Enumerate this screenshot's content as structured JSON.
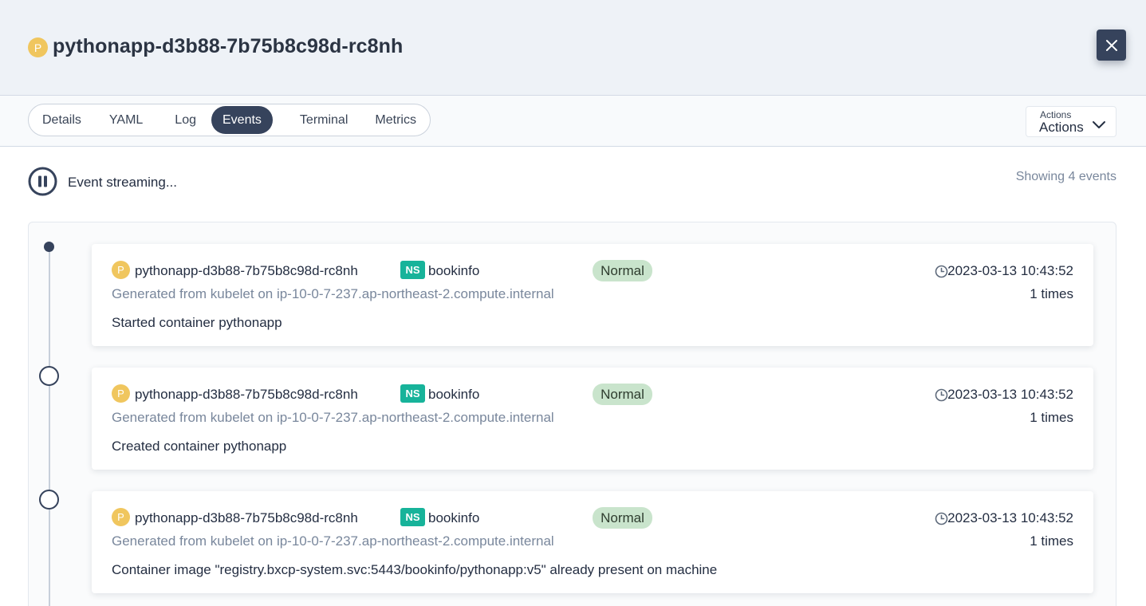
{
  "header": {
    "pod_badge": "P",
    "title": "pythonapp-d3b88-7b75b8c98d-rc8nh",
    "close_icon": "close-icon"
  },
  "tabs": [
    {
      "label": "Details",
      "active": false
    },
    {
      "label": "YAML",
      "active": false
    },
    {
      "label": "Log",
      "active": false
    },
    {
      "label": "Events",
      "active": true
    },
    {
      "label": "Terminal",
      "active": false
    },
    {
      "label": "Metrics",
      "active": false
    }
  ],
  "actions": {
    "small_label": "Actions",
    "label": "Actions"
  },
  "stream": {
    "label": "Event streaming...",
    "showing": "Showing 4 events"
  },
  "events": [
    {
      "pod_badge": "P",
      "pod": "pythonapp-d3b88-7b75b8c98d-rc8nh",
      "ns_badge": "NS",
      "namespace": "bookinfo",
      "type": "Normal",
      "time": "2023-03-13 10:43:52",
      "source": "Generated from kubelet on ip-10-0-7-237.ap-northeast-2.compute.internal",
      "count": "1 times",
      "message": "Started container pythonapp"
    },
    {
      "pod_badge": "P",
      "pod": "pythonapp-d3b88-7b75b8c98d-rc8nh",
      "ns_badge": "NS",
      "namespace": "bookinfo",
      "type": "Normal",
      "time": "2023-03-13 10:43:52",
      "source": "Generated from kubelet on ip-10-0-7-237.ap-northeast-2.compute.internal",
      "count": "1 times",
      "message": "Created container pythonapp"
    },
    {
      "pod_badge": "P",
      "pod": "pythonapp-d3b88-7b75b8c98d-rc8nh",
      "ns_badge": "NS",
      "namespace": "bookinfo",
      "type": "Normal",
      "time": "2023-03-13 10:43:52",
      "source": "Generated from kubelet on ip-10-0-7-237.ap-northeast-2.compute.internal",
      "count": "1 times",
      "message": "Container image \"registry.bxcp-system.svc:5443/bookinfo/pythonapp:v5\" already present on machine"
    }
  ],
  "colors": {
    "primary": "#36435c",
    "pod_badge": "#f0c65e",
    "ns_badge": "#17b39a",
    "normal_badge": "#c9e4cc",
    "header_bg": "#eef2f7"
  }
}
